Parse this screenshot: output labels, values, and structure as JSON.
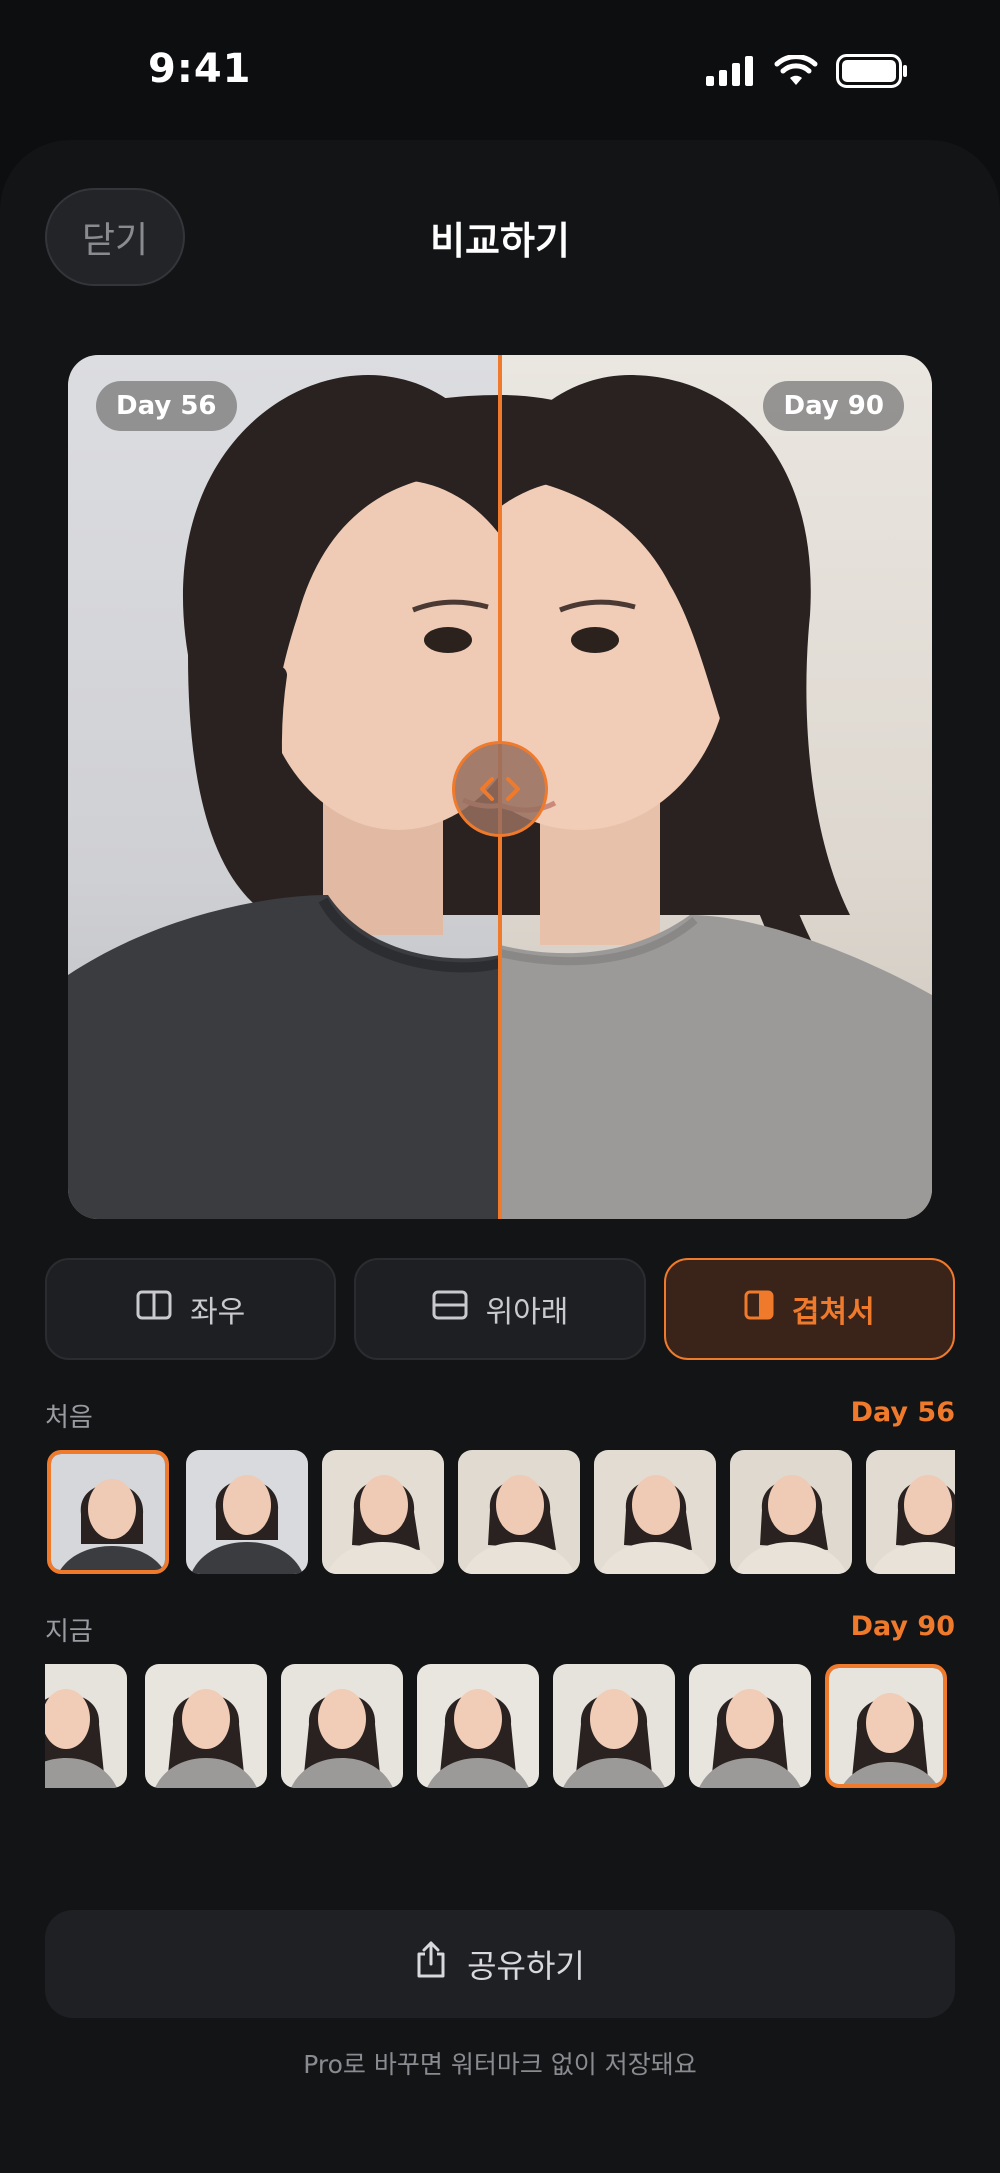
{
  "status": {
    "time": "9:41"
  },
  "header": {
    "close_label": "닫기",
    "title": "비교하기"
  },
  "compare": {
    "left_day": "Day 56",
    "right_day": "Day 90",
    "divider_position": 0.5
  },
  "modes": [
    {
      "label": "좌우",
      "icon": "split-vertical-icon",
      "active": false
    },
    {
      "label": "위아래",
      "icon": "split-horizontal-icon",
      "active": false
    },
    {
      "label": "겹쳐서",
      "icon": "overlay-icon",
      "active": true
    }
  ],
  "first_row": {
    "label": "처음",
    "day": "Day 56",
    "thumb_count": 7,
    "selected_index": 0
  },
  "now_row": {
    "label": "지금",
    "day": "Day 90",
    "thumb_count": 7,
    "selected_index": 6
  },
  "share": {
    "label": "공유하기",
    "icon": "share-icon"
  },
  "footer_note": "Pro로 바꾸면 워터마크 없이 저장돼요",
  "colors": {
    "accent": "#f07a2c",
    "background": "#0d0e10",
    "sheet": "#131416"
  }
}
